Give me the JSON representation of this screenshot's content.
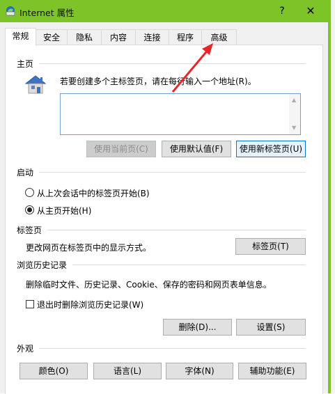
{
  "window": {
    "title": "Internet 属性",
    "help_glyph": "?",
    "close_glyph": "✕",
    "accent_color": "#7cc427"
  },
  "tabs": [
    {
      "label": "常规",
      "active": true
    },
    {
      "label": "安全"
    },
    {
      "label": "隐私"
    },
    {
      "label": "内容"
    },
    {
      "label": "连接"
    },
    {
      "label": "程序"
    },
    {
      "label": "高级"
    }
  ],
  "home": {
    "header": "主页",
    "description": "若要创建多个主标签页，请在每行输入一个地址(R)。",
    "address_value": "",
    "use_current_label": "使用当前页(C)",
    "use_default_label": "使用默认值(F)",
    "use_new_tab_label": "使用新标签页(U)"
  },
  "startup": {
    "header": "启动",
    "option_last_session": "从上次会话中的标签页开始(B)",
    "option_home": "从主页开始(H)",
    "selected": "option_home"
  },
  "tabs_section": {
    "header": "标签页",
    "description": "更改网页在标签页中的显示方式。",
    "button_label": "标签页(T)"
  },
  "history": {
    "header": "浏览历史记录",
    "description": "删除临时文件、历史记录、Cookie、保存的密码和网页表单信息。",
    "delete_on_exit_label": "退出时删除浏览历史记录(W)",
    "delete_on_exit_checked": false,
    "delete_button": "删除(D)...",
    "settings_button": "设置(S)"
  },
  "appearance": {
    "header": "外观",
    "colors_button": "颜色(O)",
    "languages_button": "语言(L)",
    "fonts_button": "字体(N)",
    "accessibility_button": "辅助功能(E)"
  }
}
